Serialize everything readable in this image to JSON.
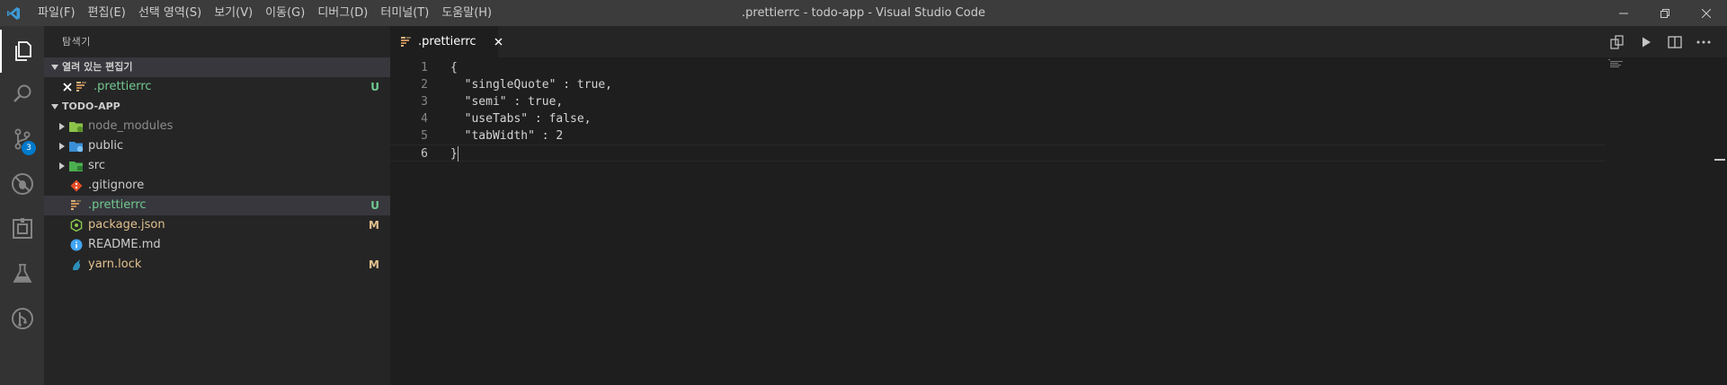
{
  "window": {
    "title": ".prettierrc - todo-app - Visual Studio Code"
  },
  "menubar": {
    "items": [
      "파일(F)",
      "편집(E)",
      "선택 영역(S)",
      "보기(V)",
      "이동(G)",
      "디버그(D)",
      "터미널(T)",
      "도움말(H)"
    ]
  },
  "activitybar": {
    "icons": [
      "files-icon",
      "search-icon",
      "source-control-icon",
      "debug-icon",
      "extensions-icon",
      "test-flask-icon",
      "git-graph-icon"
    ],
    "scm_badge": "3"
  },
  "sidebar": {
    "title": "탐색기",
    "open_editors": {
      "header": "열려 있는 편집기",
      "items": [
        {
          "name": ".prettierrc",
          "decoration": "U"
        }
      ]
    },
    "project": {
      "header": "TODO-APP",
      "items": [
        {
          "name": "node_modules",
          "decoration": ""
        },
        {
          "name": "public",
          "decoration": ""
        },
        {
          "name": "src",
          "decoration": ""
        },
        {
          "name": ".gitignore",
          "decoration": ""
        },
        {
          "name": ".prettierrc",
          "decoration": "U"
        },
        {
          "name": "package.json",
          "decoration": "M"
        },
        {
          "name": "README.md",
          "decoration": ""
        },
        {
          "name": "yarn.lock",
          "decoration": "M"
        }
      ]
    }
  },
  "editor": {
    "tab": {
      "label": ".prettierrc"
    },
    "line_numbers": [
      "1",
      "2",
      "3",
      "4",
      "5",
      "6"
    ],
    "lines": [
      "{",
      "  \"singleQuote\" : true,",
      "  \"semi\" : true,",
      "  \"useTabs\" : false,",
      "  \"tabWidth\" : 2",
      "}"
    ]
  },
  "colors": {
    "accent": "#007acc",
    "untracked": "#73c991",
    "modified": "#e2c08d"
  }
}
